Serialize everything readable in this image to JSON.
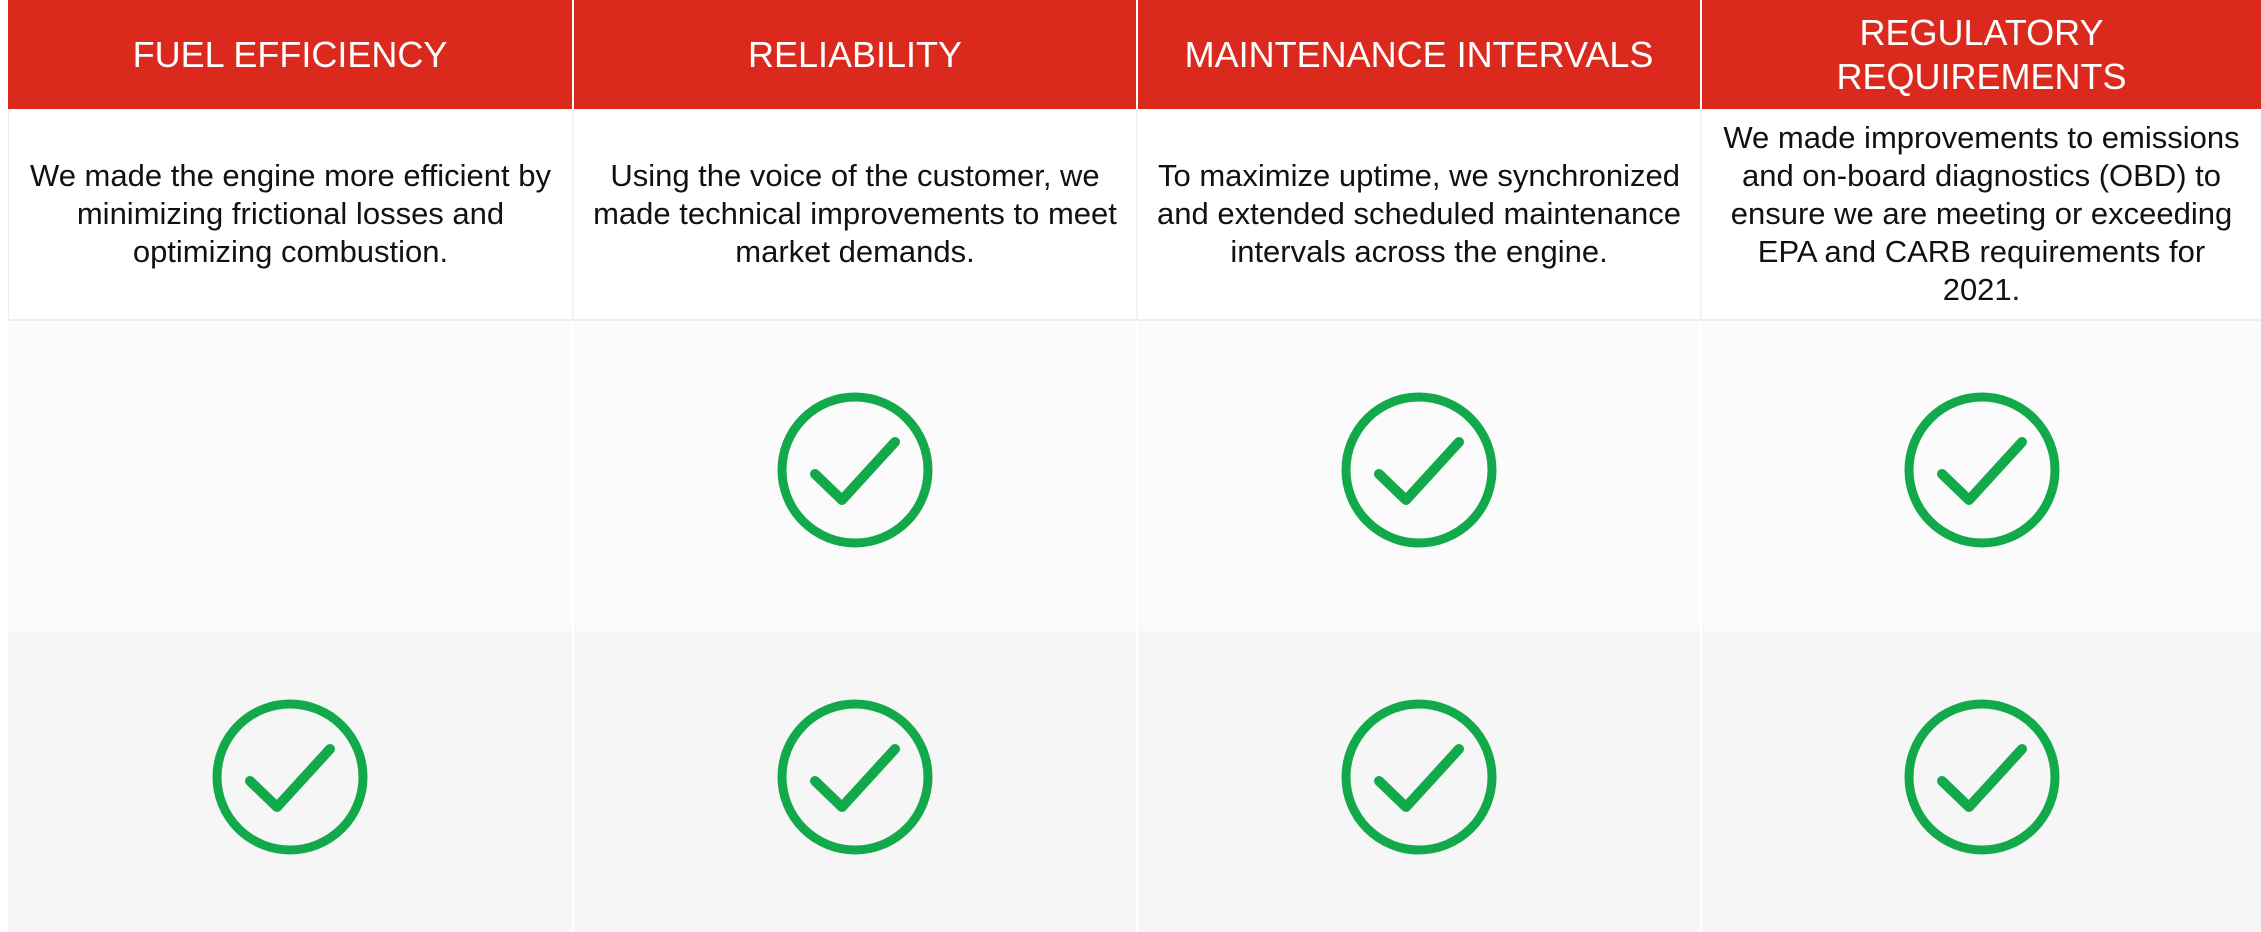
{
  "colors": {
    "header_bg": "#dc291e",
    "header_text": "#ffffff",
    "check_green": "#12a94b"
  },
  "columns": [
    {
      "header": "FUEL EFFICIENCY",
      "description": "We made the engine more efficient by minimizing frictional losses and optimizing combustion.",
      "row1_check": false,
      "row2_check": true
    },
    {
      "header": "RELIABILITY",
      "description": "Using the voice of the customer, we made technical improvements to meet market demands.",
      "row1_check": true,
      "row2_check": true
    },
    {
      "header": "MAINTENANCE INTERVALS",
      "description": "To maximize uptime, we synchronized and extended scheduled maintenance intervals across the engine.",
      "row1_check": true,
      "row2_check": true
    },
    {
      "header": "REGULATORY REQUIREMENTS",
      "description": "We made improvements to emissions and on-board diagnostics (OBD) to ensure we are meeting or exceeding EPA and CARB requirements for 2021.",
      "row1_check": true,
      "row2_check": true
    }
  ],
  "icons": {
    "check": "check-circle-icon"
  }
}
